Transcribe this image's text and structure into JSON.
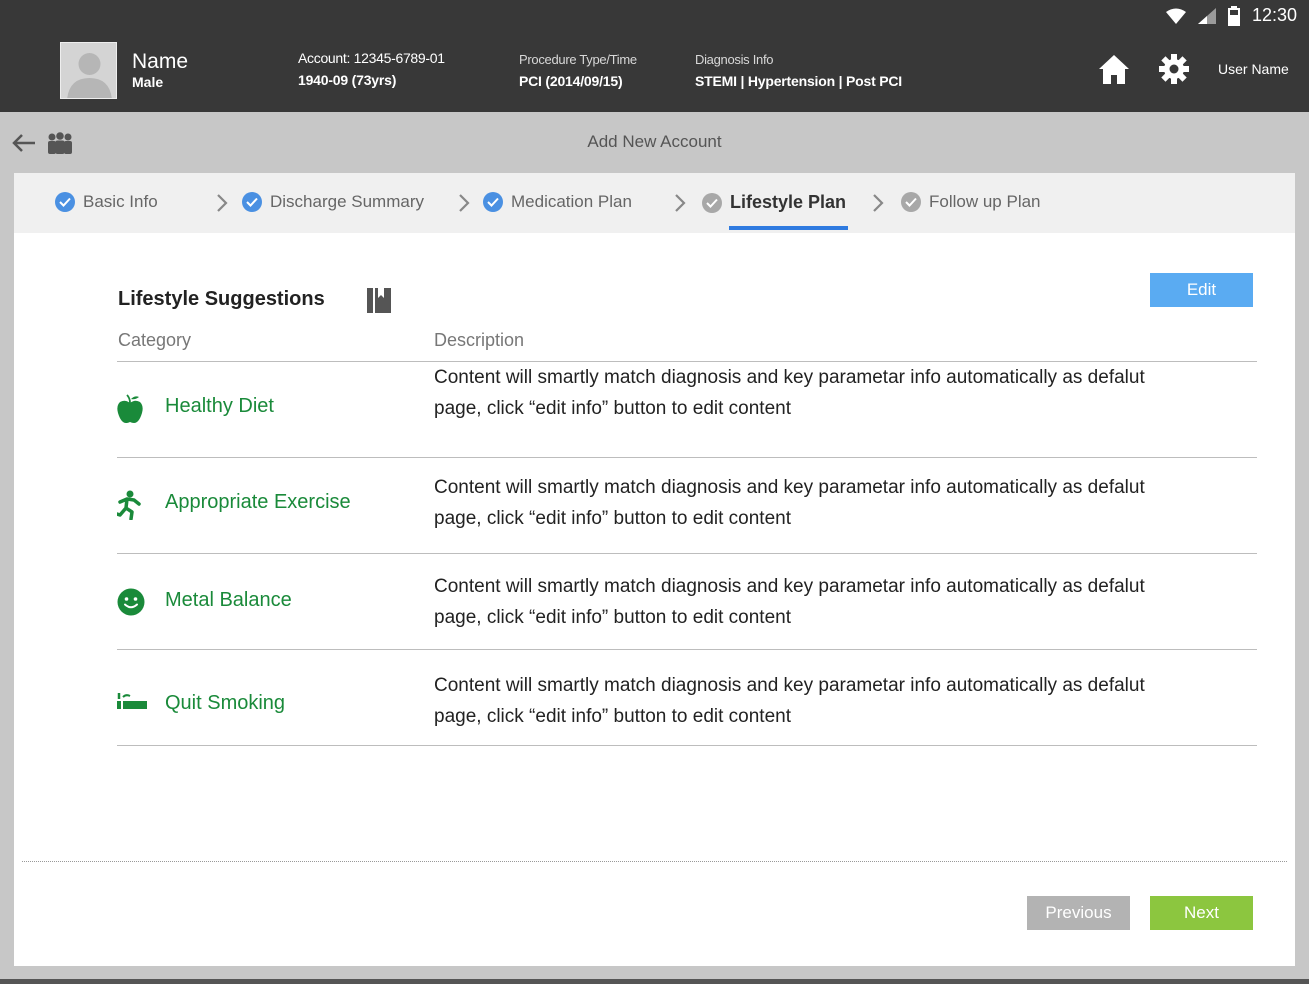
{
  "status": {
    "time": "12:30"
  },
  "patient": {
    "name": "Name",
    "gender": "Male",
    "account_label": "Account: 12345-6789-01",
    "birth": "1940-09 (73yrs)",
    "procedure_label": "Procedure Type/Time",
    "procedure_value": "PCI (2014/09/15)",
    "diagnosis_label": "Diagnosis Info",
    "diagnosis_value": "STEMI | Hypertension | Post PCI"
  },
  "header": {
    "user_name": "User Name"
  },
  "page": {
    "title": "Add New Account"
  },
  "steps": [
    {
      "label": "Basic Info",
      "state": "done"
    },
    {
      "label": "Discharge Summary",
      "state": "done"
    },
    {
      "label": "Medication Plan",
      "state": "done"
    },
    {
      "label": "Lifestyle Plan",
      "state": "active"
    },
    {
      "label": "Follow up Plan",
      "state": "todo"
    }
  ],
  "section": {
    "title": "Lifestyle Suggestions",
    "edit_label": "Edit",
    "col_category": "Category",
    "col_description": "Description"
  },
  "rows": [
    {
      "icon": "apple-icon",
      "category": "Healthy Diet",
      "description": "Content will smartly match diagnosis and key parametar info automatically as defalut page, click “edit info” button to edit content"
    },
    {
      "icon": "running-person-icon",
      "category": "Appropriate Exercise",
      "description": "Content will smartly match diagnosis and key parametar info automatically as defalut page, click “edit info” button to edit content"
    },
    {
      "icon": "smiley-icon",
      "category": "Metal Balance",
      "description": "Content will smartly match diagnosis and key parametar info automatically as defalut page, click “edit info” button to edit content"
    },
    {
      "icon": "cigarette-icon",
      "category": "Quit Smoking",
      "description": "Content will smartly match diagnosis and key parametar info automatically as defalut page, click “edit info” button to edit content"
    }
  ],
  "footer": {
    "previous_label": "Previous",
    "next_label": "Next"
  },
  "colors": {
    "accent_blue": "#5aabf2",
    "category_green": "#1a8a3a",
    "next_green": "#8cc63f",
    "header_dark": "#383838"
  }
}
